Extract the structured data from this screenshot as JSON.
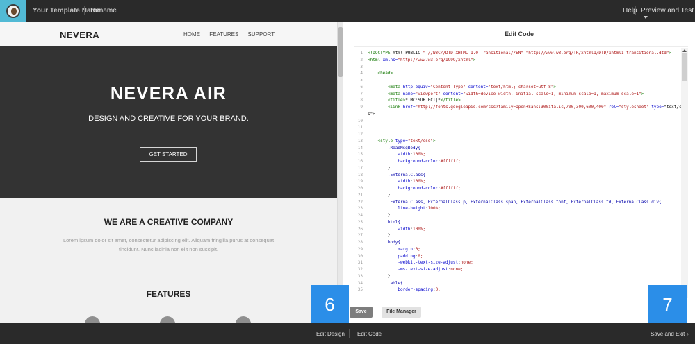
{
  "topbar": {
    "template_name": "Your Template Name",
    "rename": "Rename",
    "help": "Help",
    "preview": "Preview and Test"
  },
  "preview": {
    "brand": "NEVERA",
    "nav": [
      "HOME",
      "FEATURES",
      "SUPPORT"
    ],
    "hero_title": "NEVERA AIR",
    "hero_subtitle": "DESIGN AND CREATIVE FOR YOUR BRAND.",
    "hero_button": "GET STARTED",
    "section_title": "WE ARE A CREATIVE COMPANY",
    "lorem": "Lorem ipsum dolor sit amet, consectetur adipiscing elit. Aliquam fringilla purus at consequat tincidunt. Nunc lacinia non elit non suscipit.",
    "features_title": "FEATURES"
  },
  "editor": {
    "title": "Edit Code",
    "save": "Save",
    "file_manager": "File Manager",
    "lines": [
      {
        "n": "1",
        "t": "<!DOCTYPE html PUBLIC \"-//W3C//DTD XHTML 1.0 Transitional//EN\" \"http://www.w3.org/TR/xhtml1/DTD/xhtml1-transitional.dtd\">"
      },
      {
        "n": "2",
        "t": "<html xmlns=\"http://www.w3.org/1999/xhtml\">"
      },
      {
        "n": "3",
        "t": ""
      },
      {
        "n": "4",
        "t": "    <head>"
      },
      {
        "n": "5",
        "t": ""
      },
      {
        "n": "6",
        "t": "        <meta http-equiv=\"Content-Type\" content=\"text/html; charset=utf-8\">"
      },
      {
        "n": "7",
        "t": "        <meta name=\"viewport\" content=\"width=device-width, initial-scale=1, minimum-scale=1, maximum-scale=1\">"
      },
      {
        "n": "8",
        "t": "        <title>*|MC:SUBJECT|*</title>"
      },
      {
        "n": "9",
        "t": "        <link href=\"http://fonts.googleapis.com/css?family=Open+Sans:300italic,700,300,600,400\" rel=\"stylesheet\" type=\"text/cs"
      },
      {
        "n": "",
        "t": "s\">"
      },
      {
        "n": "10",
        "t": ""
      },
      {
        "n": "11",
        "t": ""
      },
      {
        "n": "12",
        "t": ""
      },
      {
        "n": "13",
        "t": "    <style type=\"text/css\">"
      },
      {
        "n": "14",
        "t": "        .ReadMsgBody{"
      },
      {
        "n": "15",
        "t": "            width:100%;"
      },
      {
        "n": "16",
        "t": "            background-color:#ffffff;"
      },
      {
        "n": "17",
        "t": "        }"
      },
      {
        "n": "18",
        "t": "        .ExternalClass{"
      },
      {
        "n": "19",
        "t": "            width:100%;"
      },
      {
        "n": "20",
        "t": "            background-color:#ffffff;"
      },
      {
        "n": "21",
        "t": "        }"
      },
      {
        "n": "22",
        "t": "        .ExternalClass,.ExternalClass p,.ExternalClass span,.ExternalClass font,.ExternalClass td,.ExternalClass div{"
      },
      {
        "n": "23",
        "t": "            line-height:100%;"
      },
      {
        "n": "24",
        "t": "        }"
      },
      {
        "n": "25",
        "t": "        html{"
      },
      {
        "n": "26",
        "t": "            width:100%;"
      },
      {
        "n": "27",
        "t": "        }"
      },
      {
        "n": "28",
        "t": "        body{"
      },
      {
        "n": "29",
        "t": "            margin:0;"
      },
      {
        "n": "30",
        "t": "            padding:0;"
      },
      {
        "n": "31",
        "t": "            -webkit-text-size-adjust:none;"
      },
      {
        "n": "32",
        "t": "            -ms-text-size-adjust:none;"
      },
      {
        "n": "33",
        "t": "        }"
      },
      {
        "n": "34",
        "t": "        table{"
      },
      {
        "n": "35",
        "t": "            border-spacing:0;"
      }
    ]
  },
  "badges": {
    "six": "6",
    "seven": "7"
  },
  "bottombar": {
    "edit_design": "Edit Design",
    "edit_code": "Edit Code",
    "save_exit": "Save and Exit"
  },
  "colors": {
    "accent": "#2b8ee8",
    "logo_bg": "#52bad5",
    "topbar_bg": "#2a2a2a",
    "hero_bg": "#333333"
  }
}
